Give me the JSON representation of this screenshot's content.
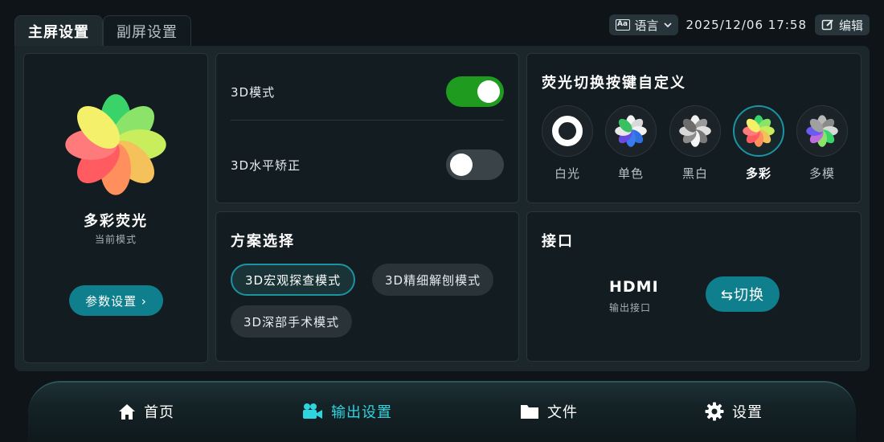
{
  "tabs": [
    "主屏设置",
    "副屏设置"
  ],
  "header": {
    "language_label": "语言",
    "language_icon_text": "Aa",
    "datetime": "2025/12/06 17:58",
    "edit_label": "编辑"
  },
  "mode_card": {
    "icon": "multicolor-flower-icon",
    "name": "多彩荧光",
    "subtitle": "当前模式",
    "param_button": "参数设置 ›"
  },
  "card_3d": {
    "mode_label": "3D模式",
    "mode_on": true,
    "horizontal_label": "3D水平矫正",
    "horizontal_on": false
  },
  "scheme": {
    "title": "方案选择",
    "options": [
      "3D宏观探查模式",
      "3D精细解刨模式",
      "3D深部手术模式"
    ],
    "selected": "3D宏观探查模式"
  },
  "fluorescence": {
    "title": "荧光切换按键自定义",
    "options": [
      "白光",
      "单色",
      "黑白",
      "多彩",
      "多模"
    ],
    "selected": "多彩"
  },
  "interface": {
    "title": "接口",
    "name": "HDMI",
    "subtitle": "输出接口",
    "switch_button": "⇆切换"
  },
  "nav": {
    "items": [
      "首页",
      "输出设置",
      "文件",
      "设置"
    ],
    "active": "输出设置"
  },
  "colors": {
    "accent": "#0f7f8d",
    "accent_highlight": "#2ed4e0",
    "switch_on": "#1f9b1f",
    "background": "#0e1418",
    "card": "#131c20"
  }
}
